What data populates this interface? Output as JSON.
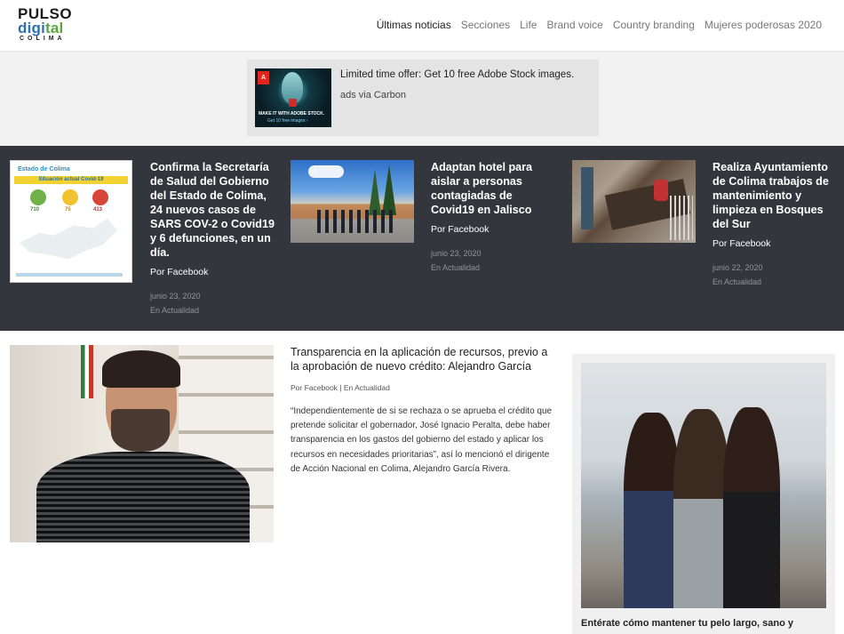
{
  "logo": {
    "line1": "PULSO",
    "line2a": "digi",
    "line2b": "tal",
    "line3": "COLIMA"
  },
  "nav": [
    {
      "label": "Últimas noticias",
      "active": true
    },
    {
      "label": "Secciones",
      "active": false
    },
    {
      "label": "Life",
      "active": false
    },
    {
      "label": "Brand voice",
      "active": false
    },
    {
      "label": "Country branding",
      "active": false
    },
    {
      "label": "Mujeres poderosas 2020",
      "active": false
    }
  ],
  "ad": {
    "text": "Limited time offer: Get 10 free Adobe Stock images.",
    "via": "ads via Carbon",
    "img_logo": "A",
    "img_line1": "MAKE IT WITH ADOBE STOCK.",
    "img_line2": "Get 10 free images ›"
  },
  "featured": [
    {
      "title": "Confirma la Secretaría de Salud del Gobierno del Estado de Colima, 24 nuevos casos de SARS COV-2 o Covid19 y 6 defunciones, en un día.",
      "byline": "Por Facebook",
      "date": "junio 23, 2020",
      "category": "En Actualidad",
      "thumb_title": "Estado de Colima",
      "thumb_bar": "Situación actual Covid-19",
      "thumb_counts": [
        "710",
        "75",
        "413"
      ]
    },
    {
      "title": "Adaptan hotel para aislar a personas contagiadas de Covid19 en Jalisco",
      "byline": "Por Facebook",
      "date": "junio 23, 2020",
      "category": "En Actualidad"
    },
    {
      "title": "Realiza Ayuntamiento de Colima trabajos de mantenimiento y limpieza en Bosques del Sur",
      "byline": "Por Facebook",
      "date": "junio 22, 2020",
      "category": "En Actualidad"
    }
  ],
  "article": {
    "title": "Transparencia en la aplicación de recursos, previo a la aprobación de nuevo crédito: Alejandro García",
    "meta": "Por Facebook | En Actualidad",
    "body": "“Independientemente de si se rechaza o se aprueba el crédito que pretende solicitar el gobernador, José Ignacio Peralta, debe haber transparencia en los gastos del gobierno del estado y aplicar los recursos en necesidades prioritarias”, así lo mencionó el dirigente de Acción Nacional en Colima, Alejandro García Rivera."
  },
  "sidebar": {
    "title": "Entérate cómo mantener tu pelo largo, sano y"
  },
  "colors": {
    "dark_band": "#33373d",
    "logo_blue": "#2f6fb5",
    "logo_green": "#5aa63f"
  }
}
